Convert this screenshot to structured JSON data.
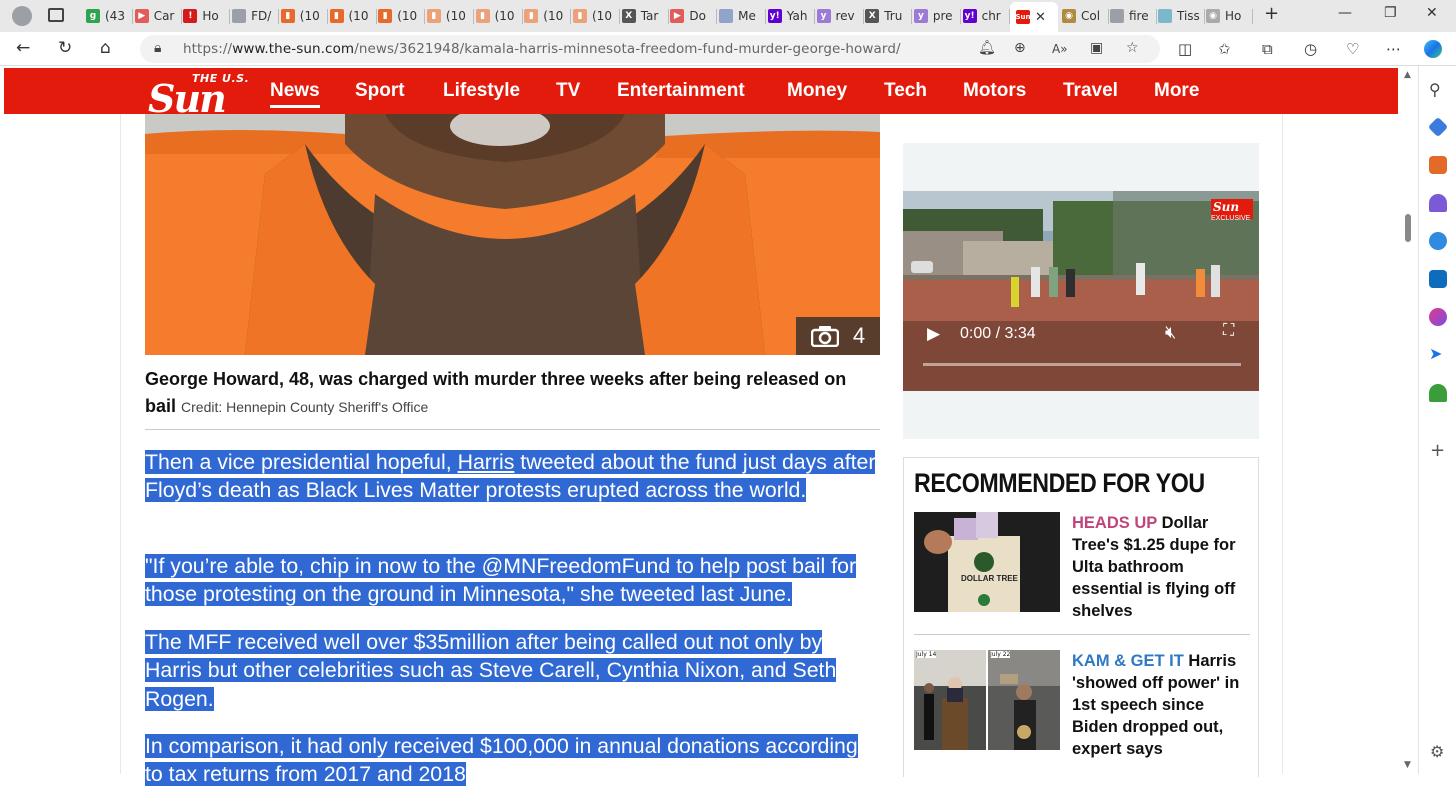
{
  "browser": {
    "tabs": [
      {
        "label": "(43",
        "color": "#2ea44f",
        "glyph": "g"
      },
      {
        "label": "Car",
        "color": "#e35c5c",
        "glyph": "▶"
      },
      {
        "label": "Ho",
        "color": "#d31b1b",
        "glyph": "!"
      },
      {
        "label": "FD/",
        "color": "#9aa0a6",
        "glyph": ""
      },
      {
        "label": "(10",
        "color": "#e8692c",
        "glyph": "▮"
      },
      {
        "label": "(10",
        "color": "#e8692c",
        "glyph": "▮"
      },
      {
        "label": "(10",
        "color": "#e8692c",
        "glyph": "▮"
      },
      {
        "label": "(10",
        "color": "#eba27a",
        "glyph": "▮"
      },
      {
        "label": "(10",
        "color": "#eba27a",
        "glyph": "▮"
      },
      {
        "label": "(10",
        "color": "#eba27a",
        "glyph": "▮"
      },
      {
        "label": "(10",
        "color": "#eba27a",
        "glyph": "▮"
      },
      {
        "label": "Tar",
        "color": "#555555",
        "glyph": "X"
      },
      {
        "label": "Do",
        "color": "#e35c5c",
        "glyph": "▶"
      },
      {
        "label": "Me",
        "color": "#8fa4c9",
        "glyph": ""
      },
      {
        "label": "Yah",
        "color": "#6001d2",
        "glyph": "y!"
      },
      {
        "label": "rev",
        "color": "#9c7ad6",
        "glyph": "y"
      },
      {
        "label": "Tru",
        "color": "#555555",
        "glyph": "X"
      },
      {
        "label": "pre",
        "color": "#9c7ad6",
        "glyph": "y"
      },
      {
        "label": "chr",
        "color": "#6001d2",
        "glyph": "y!"
      }
    ],
    "active_tab": {
      "label": "",
      "color": "#e21b0c",
      "glyph": "Sun"
    },
    "tabs_after": [
      {
        "label": "Col",
        "color": "#b08a3e",
        "glyph": "◉"
      },
      {
        "label": "fire",
        "color": "#9aa0a6",
        "glyph": ""
      },
      {
        "label": "Tiss",
        "color": "#7bb8c9",
        "glyph": ""
      },
      {
        "label": "Ho",
        "color": "#aaaaaa",
        "glyph": "◉"
      }
    ],
    "url_prefix": "https://",
    "url_domain": "www.the-sun.com",
    "url_path": "/news/3621948/kamala-harris-minnesota-freedom-fund-murder-george-howard/"
  },
  "site": {
    "logo_small": "THE U.S.",
    "logo_big": "Sun",
    "nav": [
      "News",
      "Sport",
      "Lifestyle",
      "TV",
      "Entertainment",
      "Money",
      "Tech",
      "Motors",
      "Travel",
      "More"
    ],
    "active_nav": "News"
  },
  "article": {
    "photo_count": "4",
    "caption": "George Howard, 48, was charged with murder three weeks after being released on bail",
    "credit": "Credit: Hennepin County Sheriff's Office",
    "paragraphs": [
      {
        "before_link": "Then a vice presidential hopeful, ",
        "link": "Harris",
        "after_link": " tweeted about the fund just days after Floyd’s death as Black Lives Matter protests erupted across the world. "
      },
      {
        "text": "\"If you’re able to, chip in now to the @MNFreedomFund to help post bail for those protesting on the ground in Minnesota,\" she tweeted last June."
      },
      {
        "text": "The MFF received well over $35million after being called out not only by Harris but other celebrities such as Steve Carell, Cynthia Nixon, and Seth Rogen."
      },
      {
        "text": "In comparison, it had only received $100,000 in annual donations according to tax returns from 2017 and 2018"
      }
    ]
  },
  "video": {
    "time": "0:00 / 3:34",
    "badge": "Sun",
    "badge_sub": "EXCLUSIVE"
  },
  "recommended": {
    "title": "RECOMMENDED FOR YOU",
    "items": [
      {
        "kicker": "HEADS UP",
        "headline": "Dollar Tree's $1.25 dupe for Ulta bathroom essential is flying off shelves",
        "img_label": "DOLLAR TREE"
      },
      {
        "kicker": "KAM & GET IT",
        "headline": "Harris 'showed off power' in 1st speech since Biden dropped out, expert says",
        "img_label_left": "July 14",
        "img_label_right": "July 22"
      }
    ]
  }
}
